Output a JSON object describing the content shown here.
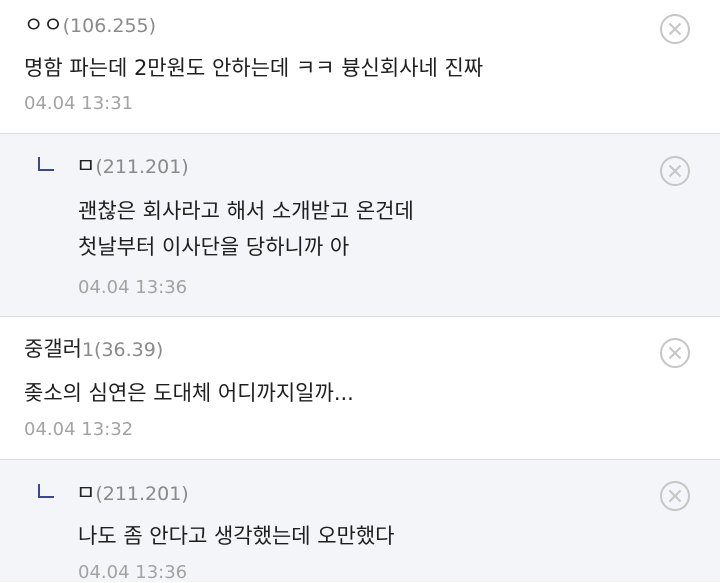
{
  "comments": [
    {
      "nickname": "ㅇㅇ",
      "ip": "(106.255)",
      "lines": [
        "명함 파는데 2만원도 안하는데 ㅋㅋ 븅신회사네 진짜"
      ],
      "date": "04.04 13:31",
      "is_reply": false
    },
    {
      "nickname": "ㅁ",
      "ip": "(211.201)",
      "lines": [
        "괜찮은 회사라고 해서 소개받고 온건데",
        "첫날부터 이사단을 당하니까 아"
      ],
      "date": "04.04 13:36",
      "is_reply": true
    },
    {
      "nickname": "중갤러",
      "ip": "1(36.39)",
      "lines": [
        "좆소의 심연은 도대체 어디까지일까..."
      ],
      "date": "04.04 13:32",
      "is_reply": false
    },
    {
      "nickname": "ㅁ",
      "ip": "(211.201)",
      "lines": [
        "나도 좀 안다고 생각했는데 오만했다"
      ],
      "date": "04.04 13:36",
      "is_reply": true
    }
  ],
  "icons": {
    "delete": "close-circle-icon",
    "reply": "reply-arrow-icon"
  },
  "colors": {
    "reply_bg": "#f4f5f9",
    "reply_mark": "#3b4890",
    "meta_text": "#a3a3a3"
  }
}
